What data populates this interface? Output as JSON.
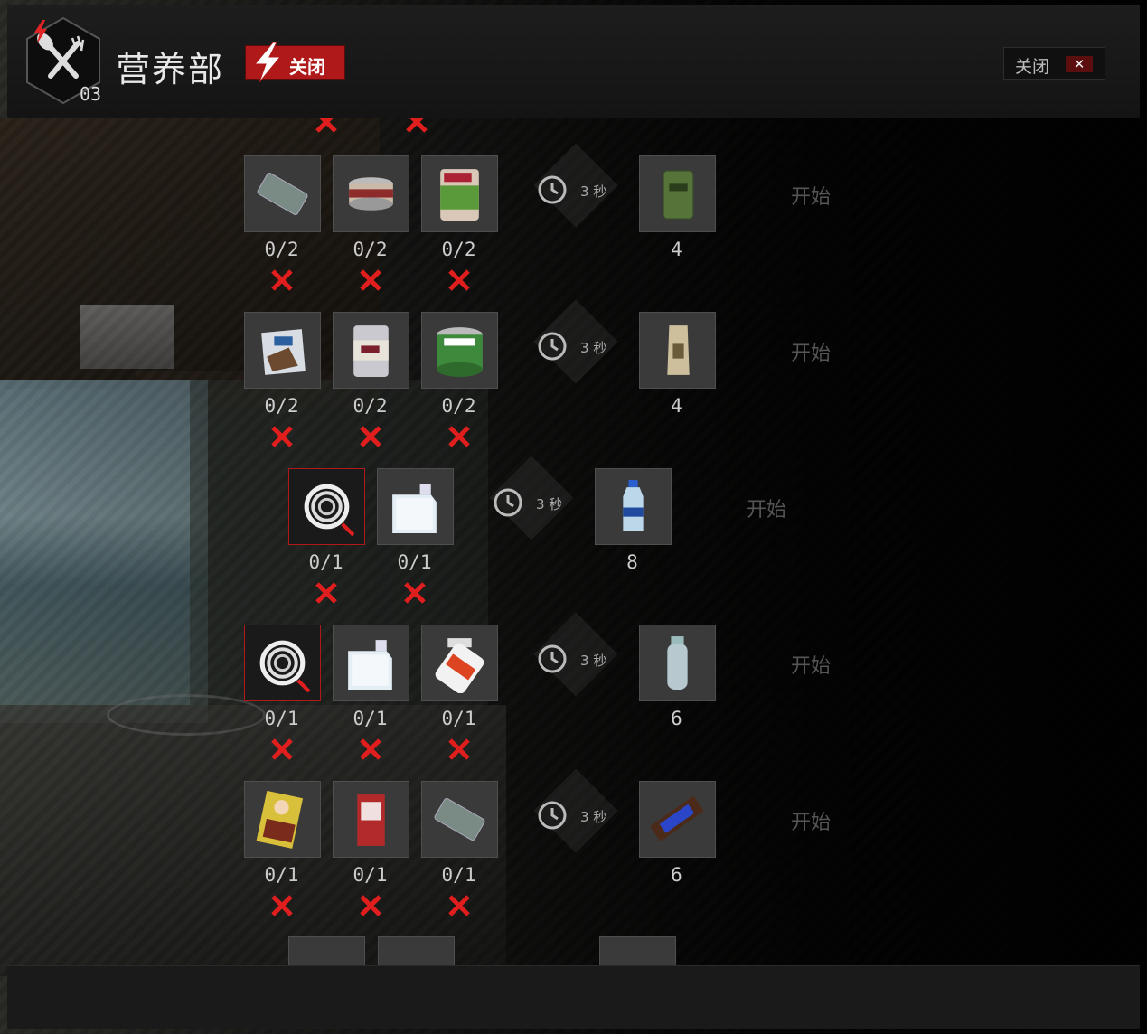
{
  "header": {
    "title": "营养部",
    "level": "03",
    "power_status": "关闭",
    "close_label": "关闭",
    "close_x": "✕"
  },
  "colors": {
    "accent_red": "#b01919",
    "text": "#cccccc",
    "muted": "#555555"
  },
  "recipes": [
    {
      "inputs": [
        {
          "name": "crackers",
          "icon": "crackers-icon",
          "count": "0/2",
          "tool": false
        },
        {
          "name": "canned-meat",
          "icon": "canned-meat-icon",
          "count": "0/2",
          "tool": false
        },
        {
          "name": "canned-peas",
          "icon": "canned-peas-icon",
          "count": "0/2",
          "tool": false
        }
      ],
      "time": "3 秒",
      "output": {
        "icon": "mre-ration-icon",
        "count": "4"
      },
      "start": "开始"
    },
    {
      "inputs": [
        {
          "name": "chips-bag",
          "icon": "chips-bag-icon",
          "count": "0/2",
          "tool": false
        },
        {
          "name": "condensed-milk",
          "icon": "condensed-milk-icon",
          "count": "0/2",
          "tool": false
        },
        {
          "name": "green-peas-can",
          "icon": "green-peas-can-icon",
          "count": "0/2",
          "tool": false
        }
      ],
      "time": "3 秒",
      "output": {
        "icon": "ration-pack-icon",
        "count": "4"
      },
      "start": "开始"
    },
    {
      "inputs": [
        {
          "name": "hose",
          "icon": "hose-icon",
          "count": "0/1",
          "tool": true
        },
        {
          "name": "water-jug",
          "icon": "water-jug-icon",
          "count": "0/1",
          "tool": false
        }
      ],
      "time": "3 秒",
      "output": {
        "icon": "water-bottle-icon",
        "count": "8"
      },
      "start": "开始"
    },
    {
      "inputs": [
        {
          "name": "hose",
          "icon": "hose-icon",
          "count": "0/1",
          "tool": true
        },
        {
          "name": "water-jug",
          "icon": "water-jug-icon",
          "count": "0/1",
          "tool": false
        },
        {
          "name": "vitamins",
          "icon": "vitamins-icon",
          "count": "0/1",
          "tool": false
        }
      ],
      "time": "3 秒",
      "output": {
        "icon": "canteen-icon",
        "count": "6"
      },
      "start": "开始"
    },
    {
      "inputs": [
        {
          "name": "chocolate-bar",
          "icon": "chocolate-bar-icon",
          "count": "0/1",
          "tool": false
        },
        {
          "name": "juice-carton",
          "icon": "juice-carton-icon",
          "count": "0/1",
          "tool": false
        },
        {
          "name": "crackers",
          "icon": "crackers-icon",
          "count": "0/1",
          "tool": false
        }
      ],
      "time": "3 秒",
      "output": {
        "icon": "slickers-bar-icon",
        "count": "6"
      },
      "start": "开始"
    }
  ]
}
